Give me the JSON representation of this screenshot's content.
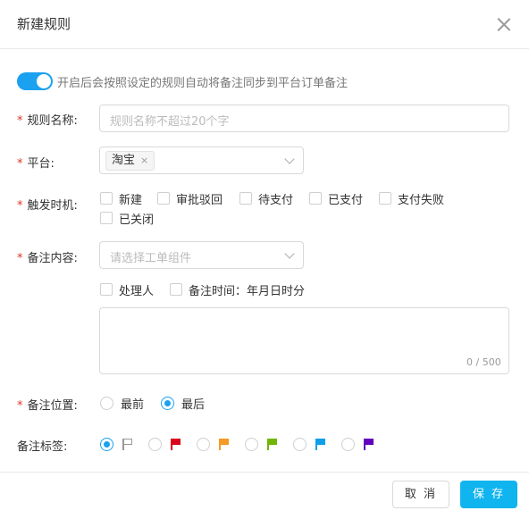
{
  "dialog": {
    "title": "新建规则"
  },
  "toggle": {
    "on": true,
    "text": "开启后会按照设定的规则自动将备注同步到平台订单备注"
  },
  "rule_name": {
    "label": "规则名称:",
    "placeholder": "规则名称不超过20个字",
    "value": ""
  },
  "platform": {
    "label": "平台:",
    "selected": "淘宝",
    "remove": "×"
  },
  "trigger": {
    "label": "触发时机:",
    "options": [
      {
        "label": "新建",
        "checked": false
      },
      {
        "label": "审批驳回",
        "checked": false
      },
      {
        "label": "待支付",
        "checked": false
      },
      {
        "label": "已支付",
        "checked": false
      },
      {
        "label": "支付失败",
        "checked": false
      },
      {
        "label": "已关闭",
        "checked": false
      }
    ]
  },
  "content": {
    "label": "备注内容:",
    "placeholder": "请选择工单组件",
    "options": [
      {
        "label": "处理人",
        "checked": false
      },
      {
        "label": "备注时间：年月日时分",
        "checked": false
      }
    ],
    "counter": "0 / 500"
  },
  "position": {
    "label": "备注位置:",
    "options": [
      {
        "label": "最前",
        "selected": false
      },
      {
        "label": "最后",
        "selected": true
      }
    ]
  },
  "tag": {
    "label": "备注标签:",
    "selected_index": 0,
    "flags": [
      {
        "icon": "flag-outline-icon",
        "color": "#999999"
      },
      {
        "icon": "flag-red-icon",
        "color": "#d9001b"
      },
      {
        "icon": "flag-orange-icon",
        "color": "#f59a23"
      },
      {
        "icon": "flag-green-icon",
        "color": "#70b603"
      },
      {
        "icon": "flag-blue-icon",
        "color": "#0f9ee9"
      },
      {
        "icon": "flag-purple-icon",
        "color": "#6300bf"
      }
    ]
  },
  "footer": {
    "cancel": "取 消",
    "save": "保 存"
  },
  "colors": {
    "accent": "#1aa1f0",
    "save_button": "#10b4ef",
    "required": "#e0341f"
  }
}
